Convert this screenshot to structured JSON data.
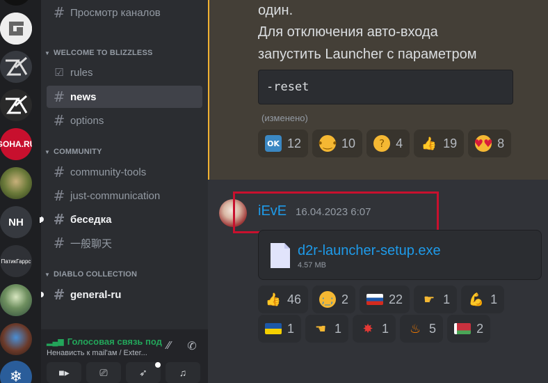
{
  "servers": [
    {
      "name": "server-top",
      "label": ""
    },
    {
      "name": "server-g",
      "label": "G"
    },
    {
      "name": "server-zt-1",
      "label": "ZT"
    },
    {
      "name": "server-zt-2",
      "label": "ZT"
    },
    {
      "name": "server-goha",
      "label": "GOHA.RU"
    },
    {
      "name": "server-image-1",
      "label": ""
    },
    {
      "name": "server-nh",
      "label": "NH"
    },
    {
      "name": "server-patik",
      "label": "ПатикГаррс"
    },
    {
      "name": "server-image-2",
      "label": ""
    },
    {
      "name": "server-image-3",
      "label": ""
    },
    {
      "name": "server-snow",
      "label": ""
    }
  ],
  "sidebar": {
    "top_channel": "Просмотр каналов",
    "categories": [
      {
        "label": "WELCOME TO BLIZZLESS"
      },
      {
        "label": "COMMUNITY"
      },
      {
        "label": "DIABLO COLLECTION"
      }
    ],
    "channels": {
      "rules": "rules",
      "news": "news",
      "options": "options",
      "community_tools": "community-tools",
      "just_communication": "just-communication",
      "besedka": "беседка",
      "chinese": "一般聊天",
      "general_ru": "general-ru"
    }
  },
  "voice": {
    "status": "Голосовая связь под",
    "channel": "Ненависть к mail'ам / Exter..."
  },
  "message1": {
    "line1": "один.",
    "line2": "Для отключения авто-входа",
    "line3": "запустить Launcher с параметром",
    "code": "-reset",
    "edited": "(изменено)",
    "reactions": [
      {
        "emoji": "OK",
        "count": "12"
      },
      {
        "emoji": "salute",
        "count": "10"
      },
      {
        "emoji": "thinking",
        "count": "4"
      },
      {
        "emoji": "thumbs-up",
        "count": "19"
      },
      {
        "emoji": "heart-eyes",
        "count": "8"
      }
    ]
  },
  "message2": {
    "author": "iEvE",
    "timestamp": "16.04.2023 6:07",
    "file_name": "d2r-launcher-setup.exe",
    "file_size": "4.57 MB",
    "reactions_row1": [
      {
        "emoji": "thumbs-up",
        "count": "46"
      },
      {
        "emoji": "crying",
        "count": "2"
      },
      {
        "emoji": "flag-russia",
        "count": "22"
      },
      {
        "emoji": "point-right",
        "count": "1"
      },
      {
        "emoji": "flexed-biceps",
        "count": "1"
      }
    ],
    "reactions_row2": [
      {
        "emoji": "flag-ukraine",
        "count": "1"
      },
      {
        "emoji": "point-left",
        "count": "1"
      },
      {
        "emoji": "collision",
        "count": "1"
      },
      {
        "emoji": "fire",
        "count": "5"
      },
      {
        "emoji": "flag-belarus",
        "count": "2"
      }
    ]
  }
}
